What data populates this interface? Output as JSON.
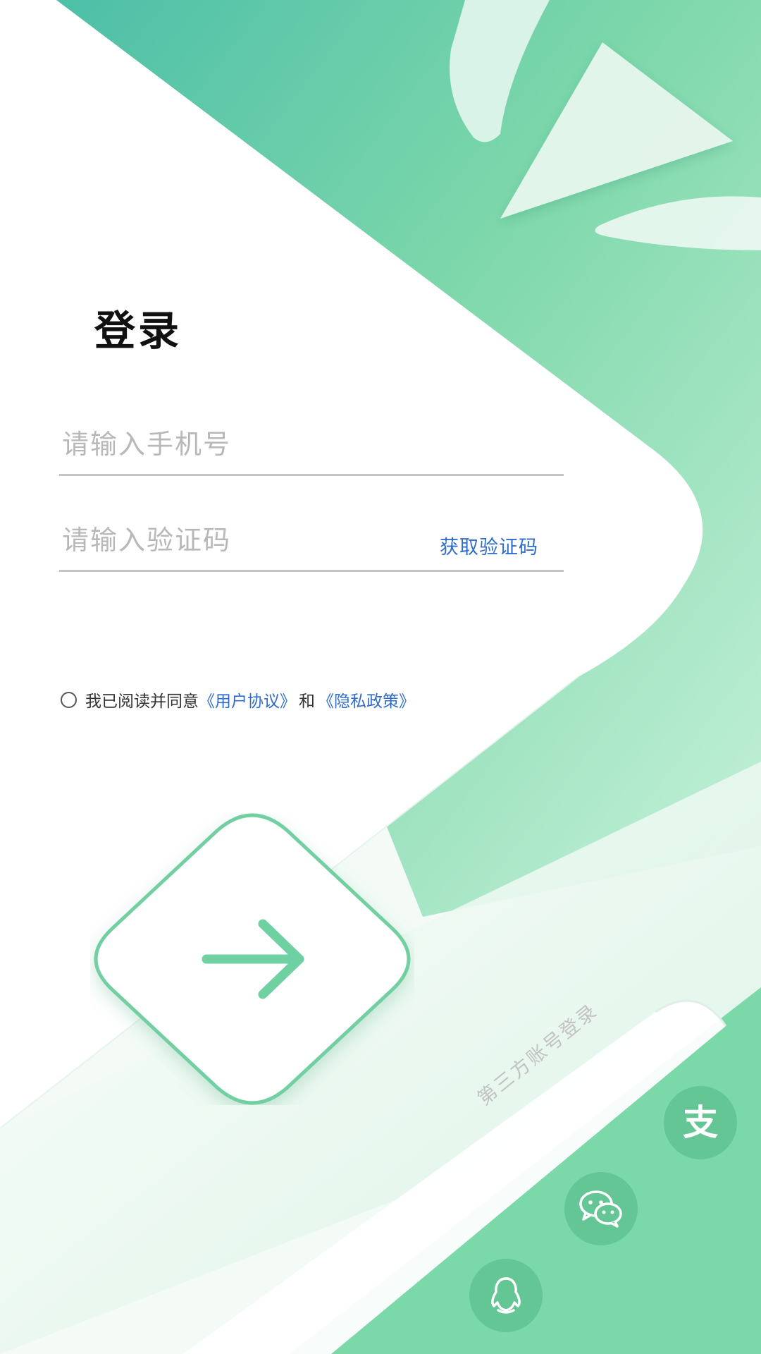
{
  "login": {
    "title": "登录",
    "phone_placeholder": "请输入手机号",
    "code_placeholder": "请输入验证码",
    "get_code_label": "获取验证码",
    "agreement": {
      "prefix": "我已阅读并同意",
      "user_agreement": "《用户协议》",
      "conjunction": "和",
      "privacy_policy": "《隐私政策》"
    },
    "third_party": {
      "label": "第三方账号登录",
      "alipay_glyph": "支",
      "buttons": [
        "alipay-icon",
        "wechat-icon",
        "qq-icon"
      ]
    }
  },
  "colors": {
    "accent_green": "#6dd3a2",
    "link_blue": "#2f6ccc",
    "placeholder_gray": "#b8b8b8"
  }
}
